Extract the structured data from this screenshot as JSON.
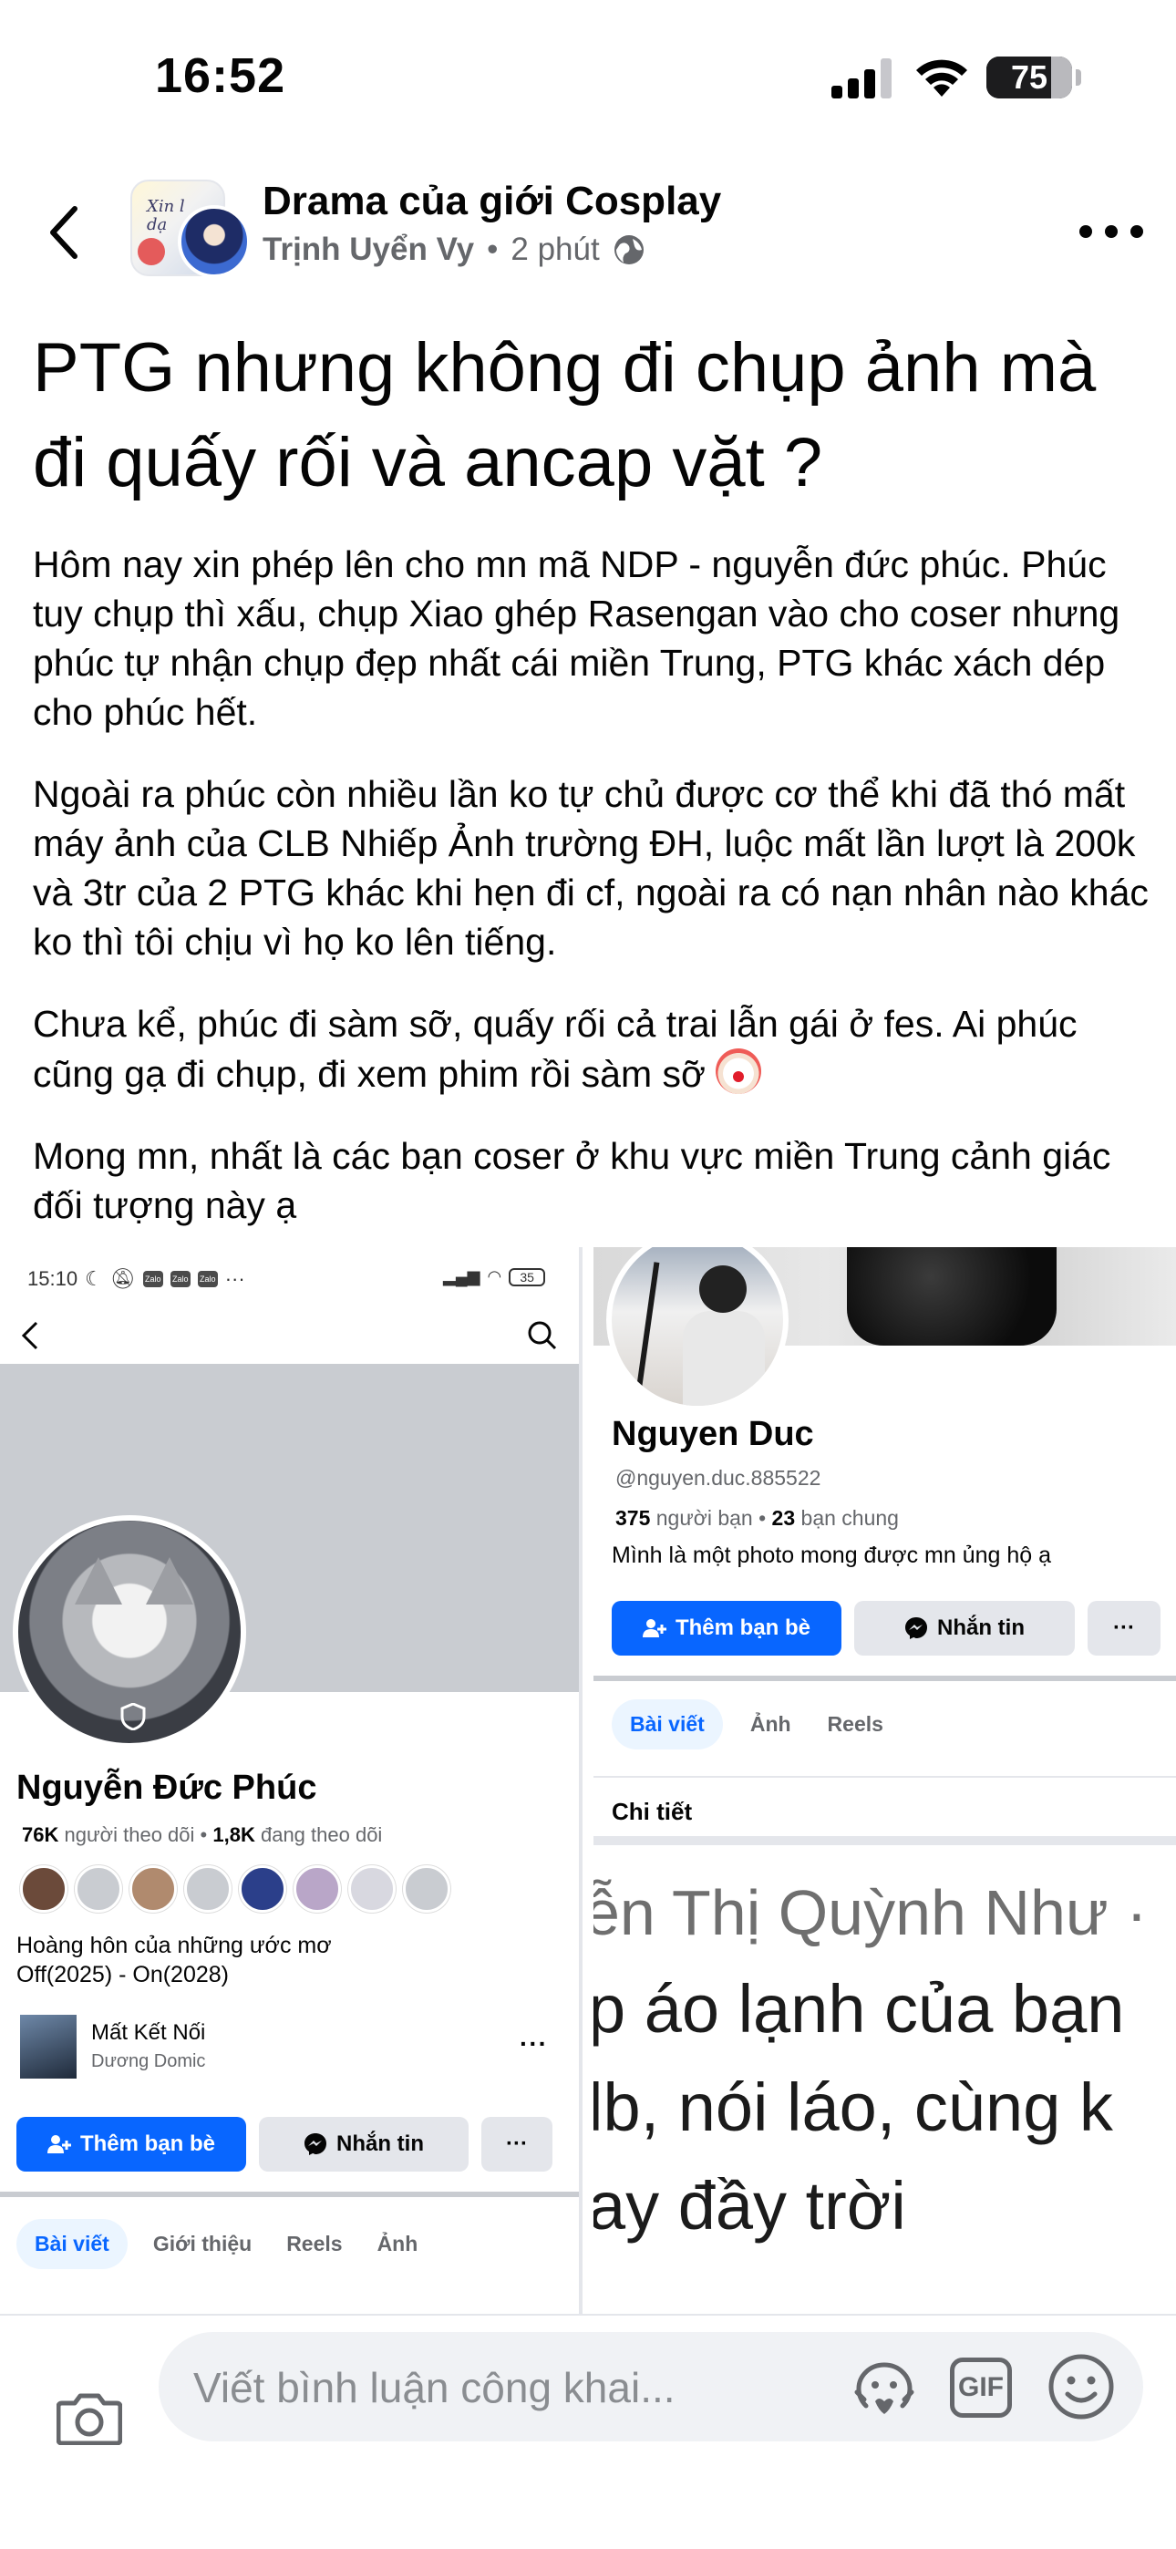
{
  "status_bar": {
    "time": "16:52",
    "battery": "75",
    "battery_level": 0.75
  },
  "post": {
    "group_name": "Drama của giới Cosplay",
    "author": "Trịnh Uyển Vy",
    "time": "2 phút",
    "title": "PTG nhưng không đi chụp ảnh mà đi quấy rối và ancap vặt ?",
    "paragraphs": [
      "Hôm nay xin phép lên cho mn mã NDP - nguyễn đức phúc. Phúc tuy chụp thì xấu, chụp Xiao ghép Rasengan vào cho coser nhưng phúc tự nhận chụp đẹp nhất cái miền Trung, PTG khác xách dép cho phúc hết.",
      "Ngoài ra phúc còn nhiều lần ko tự chủ được cơ thể khi đã thó mất máy ảnh của CLB Nhiếp Ảnh trường ĐH, luộc mất lần lượt là 200k và 3tr của 2 PTG khác khi hẹn đi cf, ngoài ra có nạn nhân nào khác ko thì tôi chịu vì họ ko lên tiếng.",
      "Chưa kể, phúc đi sàm sỡ, quấy rối cả trai lẫn gái ở fes. Ai phúc cũng gạ đi chụp, đi xem phim rồi sàm sỡ",
      "Mong mn, nhất là các bạn coser ở khu vực miền Trung cảnh giác đối tượng này ạ"
    ],
    "group_avatar_text": "Xin\ndạ"
  },
  "left_shot": {
    "status_time": "15:10",
    "zalo_label": "Zalo",
    "status_more": "···",
    "battery": "35",
    "name": "Nguyễn Đức Phúc",
    "followers_count": "76K",
    "followers_label": "người theo dõi",
    "following_count": "1,8K",
    "following_label": "đang theo dõi",
    "bio": "Hoàng hôn của những ước mơ\nOff(2025) - On(2028)",
    "music_title": "Mất Kết Nối",
    "music_artist": "Dương Domic",
    "add_friend": "Thêm bạn bè",
    "message": "Nhắn tin",
    "more": "···",
    "tabs": [
      "Bài viết",
      "Giới thiệu",
      "Reels",
      "Ảnh"
    ],
    "friend_colors": [
      "#6b4a3a",
      "#c9ccd1",
      "#b08a6e",
      "#c9ccd1",
      "#2b3f8a",
      "#b9a6c8",
      "#d8d8e0",
      "#c9ccd1"
    ]
  },
  "right_shot": {
    "name": "Nguyen Duc",
    "handle": "@nguyen.duc.885522",
    "friends_count": "375",
    "friends_label": "người bạn",
    "mutual_count": "23",
    "mutual_label": "bạn chung",
    "bio": "Mình là một photo mong được mn ủng hộ ạ",
    "add_friend": "Thêm bạn bè",
    "message": "Nhắn tin",
    "more": "···",
    "tabs": [
      "Bài viết",
      "Ảnh",
      "Reels"
    ],
    "section": "Chi tiết",
    "zoom_lines": [
      "ễn Thị Quỳnh Như ·",
      "p áo lạnh của bạn",
      "lb, nói láo, cùng k",
      "ay đầy trời"
    ]
  },
  "comment_bar": {
    "placeholder": "Viết bình luận công khai...",
    "gif_label": "GIF"
  }
}
